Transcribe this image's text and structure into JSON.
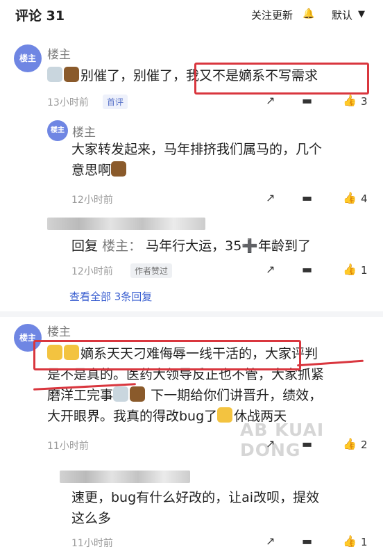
{
  "header": {
    "title": "评论 31",
    "follow_label": "关注更新",
    "bell_icon": "bell-icon",
    "sort_label": "默认",
    "sort_icon": "filter-icon"
  },
  "comments": [
    {
      "avatar": "楼主",
      "author": "楼主",
      "text": "别催了，别催了，我又不是嫡系不写需求",
      "text_parts": [
        "别催了，别催了，",
        "我又不是嫡系不写需求"
      ],
      "time": "13小时前",
      "tag": "首评",
      "likes": "3",
      "replies": [
        {
          "avatar": "楼主",
          "author": "楼主",
          "text_line1": "大家转发起来，马年排挤我们属马的，几个",
          "text_line2": "意思啊",
          "time": "12小时前",
          "likes": "4"
        },
        {
          "reply_prefix": "回复",
          "reply_to": "楼主：",
          "text": "马年行大运，35➕年龄到了",
          "time": "12小时前",
          "tag": "作者赞过",
          "likes": "1"
        }
      ],
      "more_label": "查看全部 3条回复"
    },
    {
      "avatar": "楼主",
      "author": "楼主",
      "line1": "嫡系天天刁难侮辱一线干活的，大家评判",
      "line1_parts": [
        "嫡系天天刁难侮辱一线干活的，",
        "大家评判"
      ],
      "line2": "是不是真的。医药大领导反正也不管，大家抓紧",
      "line3": "磨洋工完事",
      "line3_tail": "下一期给你们讲晋升，绩效，",
      "line4": "大开眼界。我真的得改bug了",
      "line4_tail": "休战两天",
      "time": "11小时前",
      "likes": "2",
      "replies": [
        {
          "text_line1": "速更，bug有什么好改的，让ai改呗，提效",
          "text_line2": "这么多",
          "time": "11小时前",
          "likes": "1"
        }
      ]
    }
  ],
  "watermark": "AB KUAI DONG",
  "colors": {
    "accent": "#3a5fd0",
    "highlight": "#d9363e",
    "avatar": "#6f86e3"
  }
}
